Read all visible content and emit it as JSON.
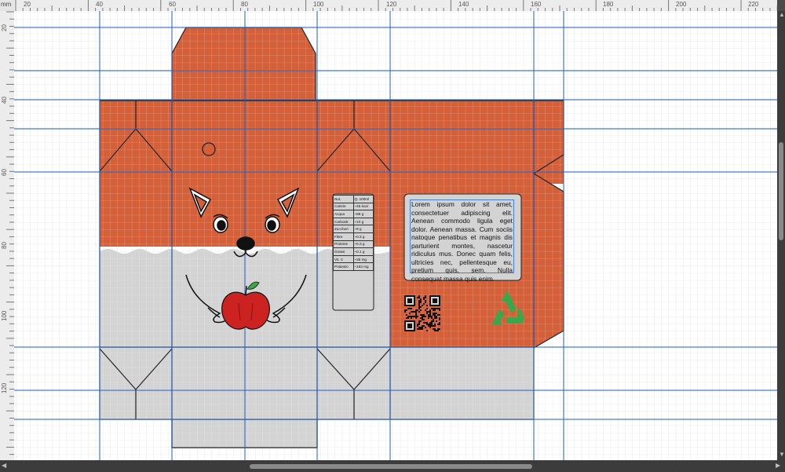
{
  "ruler": {
    "unit": "mm",
    "top_labels": [
      "20",
      "40",
      "60",
      "80",
      "100",
      "120",
      "140",
      "160",
      "180",
      "200",
      "220"
    ],
    "left_labels": [
      "20",
      "40",
      "60",
      "80",
      "100",
      "120"
    ]
  },
  "colors": {
    "fox_orange": "#d4603a",
    "body_grey": "#d3d3d3",
    "guide_blue": "#1e5fbf",
    "apple_red": "#cc2222",
    "recycle_green": "#3aa84a"
  },
  "nutrition": {
    "header": [
      "Nut.",
      "Q. 100ml"
    ],
    "rows": [
      [
        "Calorie",
        "~45 kcal"
      ],
      [
        "Acqua",
        "~88 g"
      ],
      [
        "Carboidr.",
        "~10 g"
      ],
      [
        "Zuccheri",
        "~9 g"
      ],
      [
        "Fibre",
        "~0.3 g"
      ],
      [
        "Proteine",
        "~0.3 g"
      ],
      [
        "Grassi",
        "~0.1 g"
      ],
      [
        "Vit. C",
        "~35 mg"
      ],
      [
        "Potassio",
        "~153 mg"
      ]
    ]
  },
  "lorem_text": "Lorem ipsum dolor sit amet, consectetuer adipiscing elit. Aenean commodo ligula eget dolor. Aenean massa. Cum sociis natoque penatibus et magnis dis parturient montes, nascetur ridiculus mus. Donec quam felis, ultricies nec, pellentesque eu, pretium quis, sem. Nulla consequat massa quis enim.",
  "icons": [
    "qr-code-icon",
    "recycle-icon",
    "apple-icon",
    "fox-face-icon"
  ]
}
